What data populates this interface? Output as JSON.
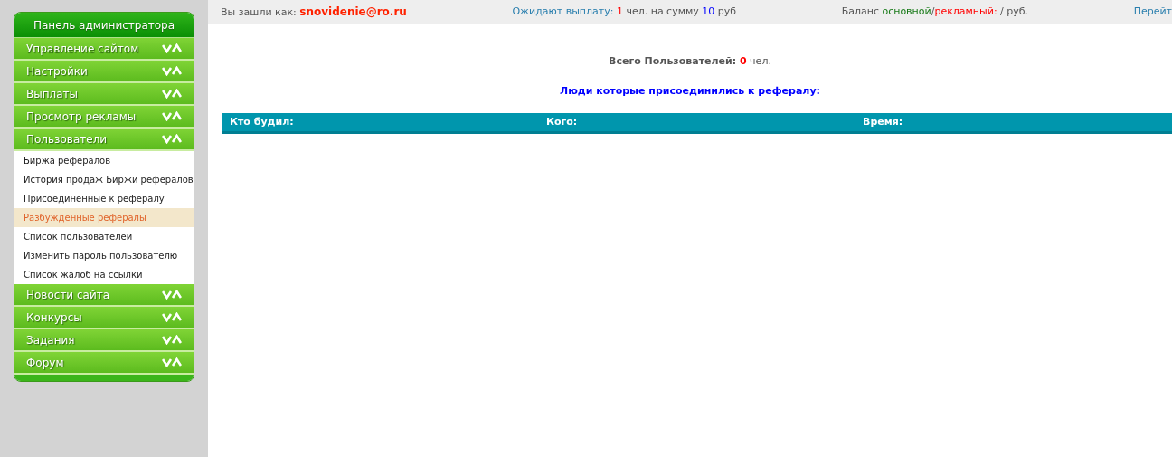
{
  "sidebar": {
    "title": "Панель администратора",
    "sections": [
      {
        "label": "Управление сайтом"
      },
      {
        "label": "Настройки"
      },
      {
        "label": "Выплаты"
      },
      {
        "label": "Просмотр рекламы"
      },
      {
        "label": "Пользователи",
        "children": [
          {
            "label": "Биржа рефералов",
            "selected": false
          },
          {
            "label": "История продаж Биржи рефералов",
            "selected": false
          },
          {
            "label": "Присоединённые к рефералу",
            "selected": false
          },
          {
            "label": "Разбуждённые рефералы",
            "selected": true
          },
          {
            "label": "Список пользователей",
            "selected": false
          },
          {
            "label": "Изменить пароль пользователю",
            "selected": false
          },
          {
            "label": "Список жалоб на ссылки",
            "selected": false
          }
        ]
      },
      {
        "label": "Новости сайта"
      },
      {
        "label": "Конкурсы"
      },
      {
        "label": "Задания"
      },
      {
        "label": "Форум"
      }
    ]
  },
  "top_bar": {
    "items": [
      [
        {
          "kind": "plain",
          "text": "Вы зашли как: "
        },
        {
          "kind": "user",
          "text": "snovidenie@ro.ru"
        }
      ],
      [
        {
          "kind": "teal",
          "text": "Ожидают выплату: "
        },
        {
          "kind": "red",
          "text": "1"
        },
        {
          "kind": "plain",
          "text": " чел. на сумму "
        },
        {
          "kind": "blue",
          "text": "10"
        },
        {
          "kind": "plain",
          "text": " руб"
        }
      ],
      [
        {
          "kind": "plain",
          "text": "Баланс "
        },
        {
          "kind": "green",
          "text": "основной"
        },
        {
          "kind": "plain",
          "text": "/"
        },
        {
          "kind": "red",
          "text": "рекламный:"
        },
        {
          "kind": "plain",
          "text": " / руб."
        }
      ]
    ],
    "link": "Перейт"
  },
  "summary": {
    "label": "Всего Пользователей:",
    "count": "0",
    "unit": "чел."
  },
  "heading": "Люди которые присоединились к рефералу:",
  "table": {
    "columns": [
      "Кто будил:",
      "Кого:",
      "Время:"
    ]
  }
}
